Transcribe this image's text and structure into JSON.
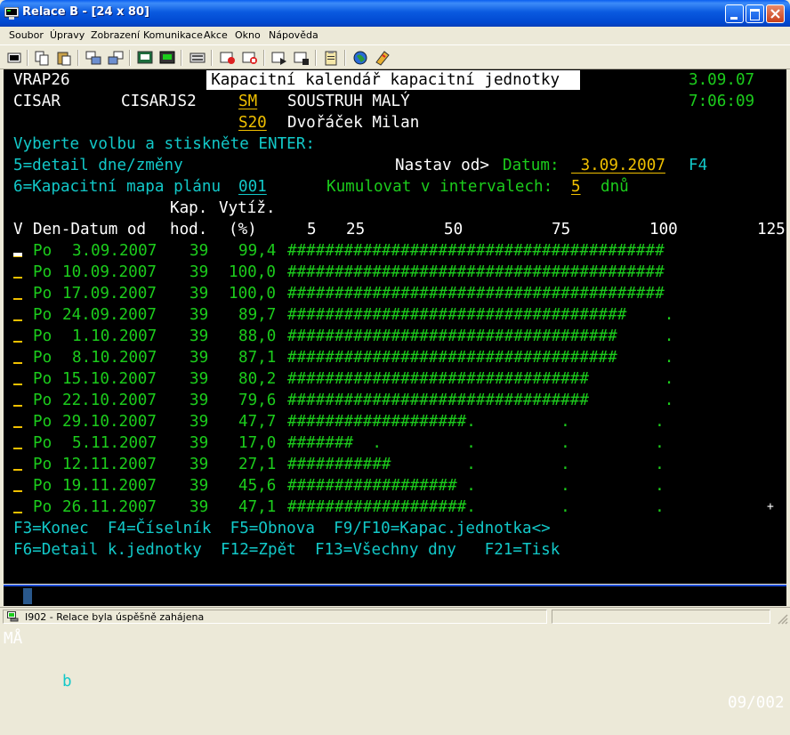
{
  "window": {
    "title": "Relace B - [24 x 80]"
  },
  "menubar": [
    {
      "label": "Soubor"
    },
    {
      "label": "Úpravy"
    },
    {
      "label": "Zobrazení"
    },
    {
      "label": "Komunikace"
    },
    {
      "label": "Akce"
    },
    {
      "label": "Okno"
    },
    {
      "label": "Nápověda"
    }
  ],
  "toolbar_icons": [
    "print-screen",
    "copy",
    "paste",
    "send",
    "receive",
    "display",
    "keyboard",
    "macro-record",
    "macro-play",
    "macro-stop",
    "macro-step",
    "clipboard",
    "globe",
    "help"
  ],
  "screen": {
    "program": "VRAP26",
    "heading": "Kapacitní kalendář kapacitní jednotky",
    "date": "3.09.07",
    "user": "CISAR",
    "workstation": "CISARJS2",
    "code1": "SM",
    "code1_desc": "SOUSTRUH MALÝ",
    "time": "7:06:09",
    "code2": "S20",
    "code2_desc": "Dvořáček Milan",
    "instruction": "Vyberte volbu a stiskněte ENTER:",
    "option5": "5=detail dne/změny",
    "nastav_label": "Nastav od>",
    "datum_label": "Datum:",
    "datum_value": " 3.09.2007",
    "f4": "F4",
    "option6": "6=Kapacitní mapa plánu",
    "map_value": "001",
    "kumulovat_label": "Kumulovat v intervalech:",
    "interval_value": "5",
    "interval_unit": "dnů",
    "col_kap": "Kap.",
    "col_vytiz": "Vytíž.",
    "col_v": "V",
    "col_den": "Den-Datum od",
    "col_hod": "hod.",
    "col_pct": "(%)",
    "scale": [
      {
        "label": "5",
        "col": 31
      },
      {
        "label": "25",
        "col": 35
      },
      {
        "label": "50",
        "col": 45
      },
      {
        "label": "75",
        "col": 56
      },
      {
        "label": "100",
        "col": 66
      },
      {
        "label": "125",
        "col": 77
      }
    ],
    "rows": [
      {
        "day": "Po",
        "date": "3.09.2007",
        "hours": "39",
        "pct": "99,4",
        "util": 99.4,
        "bar": "########################################"
      },
      {
        "day": "Po",
        "date": "10.09.2007",
        "hours": "39",
        "pct": "100,0",
        "util": 100.0,
        "bar": "########################################"
      },
      {
        "day": "Po",
        "date": "17.09.2007",
        "hours": "39",
        "pct": "100,0",
        "util": 100.0,
        "bar": "########################################"
      },
      {
        "day": "Po",
        "date": "24.09.2007",
        "hours": "39",
        "pct": "89,7",
        "util": 89.7,
        "bar": "####################################    ."
      },
      {
        "day": "Po",
        "date": "1.10.2007",
        "hours": "39",
        "pct": "88,0",
        "util": 88.0,
        "bar": "###################################     ."
      },
      {
        "day": "Po",
        "date": "8.10.2007",
        "hours": "39",
        "pct": "87,1",
        "util": 87.1,
        "bar": "###################################     ."
      },
      {
        "day": "Po",
        "date": "15.10.2007",
        "hours": "39",
        "pct": "80,2",
        "util": 80.2,
        "bar": "################################        ."
      },
      {
        "day": "Po",
        "date": "22.10.2007",
        "hours": "39",
        "pct": "79,6",
        "util": 79.6,
        "bar": "################################        ."
      },
      {
        "day": "Po",
        "date": "29.10.2007",
        "hours": "39",
        "pct": "47,7",
        "util": 47.7,
        "bar": "###################.         .         ."
      },
      {
        "day": "Po",
        "date": "5.11.2007",
        "hours": "39",
        "pct": "17,0",
        "util": 17.0,
        "bar": "#######  .         .         .         ."
      },
      {
        "day": "Po",
        "date": "12.11.2007",
        "hours": "39",
        "pct": "27,1",
        "util": 27.1,
        "bar": "###########        .         .         ."
      },
      {
        "day": "Po",
        "date": "19.11.2007",
        "hours": "39",
        "pct": "45,6",
        "util": 45.6,
        "bar": "################## .         .         ."
      },
      {
        "day": "Po",
        "date": "26.11.2007",
        "hours": "39",
        "pct": "47,1",
        "util": 47.1,
        "bar": "###################.         .         ."
      }
    ],
    "plus_marker": "+",
    "fkeys_line1": "F3=Konec  F4=Číselník  F5=Obnova  F9/F10=Kapac.jednotka<>",
    "fkeys_line2": "F6=Detail k.jednotky  F12=Zpět  F13=Všechny dny   F21=Tisk"
  },
  "oia": {
    "mode": "MÅ",
    "indicator": "b",
    "cursor_pos": "09/002"
  },
  "statusbar": {
    "message": "I902 - Relace byla úspěšně zahájena"
  },
  "colors": {
    "green": "#1ccc1c",
    "turquoise": "#12c8c8",
    "yellow": "#f0c000",
    "white": "#ffffff",
    "screen_bg": "#000000",
    "oia_blue": "#1d4bd6"
  }
}
